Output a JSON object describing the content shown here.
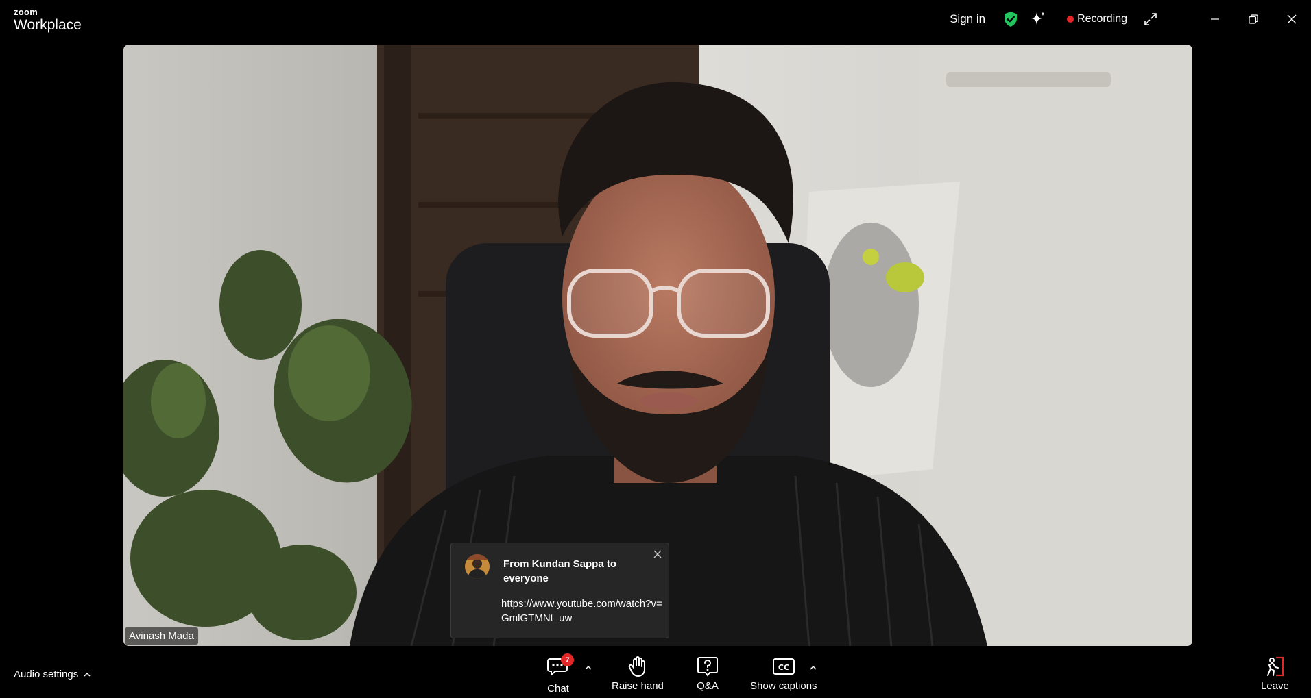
{
  "app": {
    "brand_small": "zoom",
    "brand_big": "Workplace"
  },
  "titlebar": {
    "signin_label": "Sign in",
    "recording_label": "Recording",
    "recording_color": "#e5252a",
    "shield_color": "#22c55e",
    "icons": [
      "shield-check-icon",
      "sparkle-icon",
      "expand-icon",
      "minimize-icon",
      "restore-icon",
      "close-icon"
    ]
  },
  "video": {
    "participant_name": "Avinash Mada"
  },
  "chat_toast": {
    "from": "From Kundan Sappa to everyone",
    "message": "https://www.youtube.com/watch?v=GmlGTMNt_uw"
  },
  "toolbar": {
    "audio_settings_label": "Audio settings",
    "chat_label": "Chat",
    "chat_badge": "7",
    "raise_hand_label": "Raise hand",
    "qa_label": "Q&A",
    "captions_label": "Show captions",
    "leave_label": "Leave",
    "leave_color": "#e02828"
  }
}
